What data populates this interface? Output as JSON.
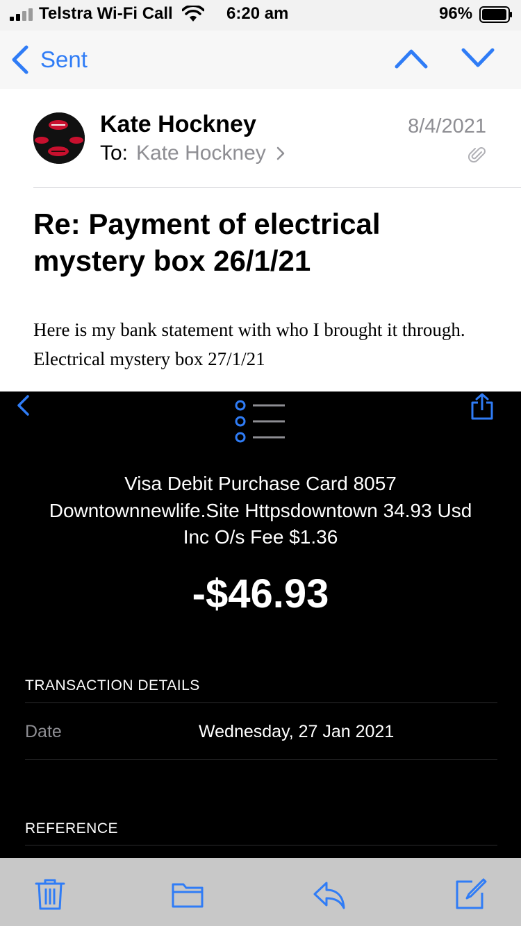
{
  "status_bar": {
    "carrier": "Telstra Wi-Fi Call",
    "time": "6:20 am",
    "battery": "96%"
  },
  "nav": {
    "back_label": "Sent"
  },
  "mail": {
    "sender": "Kate Hockney",
    "to_label": "To:",
    "to_name": "Kate Hockney",
    "date": "8/4/2021",
    "subject": "Re: Payment of electrical mystery box 26/1/21",
    "body_line1": "Here is my bank statement with who I brought it through.",
    "body_line2": "Electrical mystery box 27/1/21"
  },
  "statement": {
    "description_line1": "Visa Debit Purchase Card 8057",
    "description_line2": "Downtownnewlife.Site Httpsdowntown 34.93 Usd",
    "description_line3": "Inc O/s Fee $1.36",
    "amount": "-$46.93",
    "details_heading": "TRANSACTION DETAILS",
    "date_label": "Date",
    "date_value": "Wednesday, 27 Jan 2021",
    "reference_heading": "REFERENCE"
  },
  "colors": {
    "accent": "#2f7cf6",
    "secondary_text": "#8e8e93",
    "toolbar_bg": "#c8c8c8"
  },
  "icons": {
    "signal": "cellular-signal-icon",
    "wifi": "wifi-icon",
    "battery": "battery-icon",
    "back": "chevron-left-icon",
    "up": "chevron-up-icon",
    "down": "chevron-down-icon",
    "attachment": "paperclip-icon",
    "trash": "trash-icon",
    "folder": "folder-icon",
    "reply": "reply-icon",
    "compose": "compose-icon"
  }
}
